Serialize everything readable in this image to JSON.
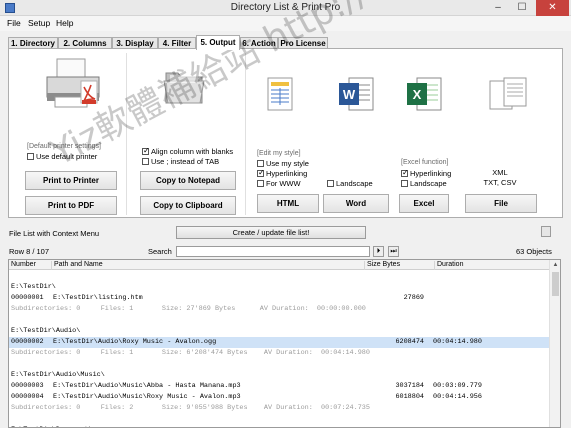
{
  "window": {
    "title": "Directory List & Print Pro",
    "minimize": "–",
    "maximize": "☐",
    "close": "✕"
  },
  "menu": [
    "File",
    "Setup",
    "Help"
  ],
  "tabs": [
    {
      "label": "1. Directory",
      "active": false
    },
    {
      "label": "2. Columns",
      "active": false
    },
    {
      "label": "3. Display",
      "active": false
    },
    {
      "label": "4. Filter",
      "active": false
    },
    {
      "label": "5. Output",
      "active": true
    },
    {
      "label": "6. Action",
      "active": false
    },
    {
      "label": "Pro License",
      "active": false
    }
  ],
  "printer": {
    "icon": "printer-pdf-icon",
    "group_label": "[Default printer settings]",
    "use_default": {
      "label": "Use default printer",
      "checked": false
    },
    "print_button": "Print to Printer",
    "pdf_button": "Print to PDF"
  },
  "clipboard": {
    "icon": "folder-icon",
    "align_columns": {
      "label": "Align column with blanks",
      "checked": true
    },
    "use_semicolon": {
      "label": "Use  ;  instead of TAB",
      "checked": false
    },
    "notepad_button": "Copy to Notepad",
    "clipboard_button": "Copy to Clipboard"
  },
  "style": {
    "icons": [
      "html-table-icon",
      "word-icon",
      "excel-icon",
      "xml-csv-icon"
    ],
    "edit_label": "[Edit my style]",
    "use_my_style": {
      "label": "Use my style",
      "checked": false
    },
    "hyperlinking": {
      "label": "Hyperlinking",
      "checked": true
    },
    "for_www": {
      "label": "For WWW",
      "checked": false
    },
    "landscape": {
      "label": "Landscape",
      "checked": false
    },
    "html_button": "HTML",
    "word_button": "Word",
    "excel_label": "[Excel function]",
    "excel_hyperlinking": {
      "label": "Hyperlinking",
      "checked": true
    },
    "excel_landscape": {
      "label": "Landscape",
      "checked": false
    },
    "excel_button": "Excel",
    "file_types": "XML\nTXT, CSV",
    "file_button": "File"
  },
  "status": {
    "context_menu": "File List with Context Menu",
    "create_button": "Create / update file list!",
    "row_counter": "Row 8 / 107",
    "search_label": "Search",
    "search_value": "",
    "next_button": "⏵",
    "last_button": "⏭",
    "objects": "63 Objects"
  },
  "list": {
    "columns": [
      "Number",
      "Path and Name",
      "Size Bytes",
      "Duration"
    ],
    "rows": [
      {
        "type": "blank",
        "text": ""
      },
      {
        "type": "dir",
        "text": "E:\\TestDir\\"
      },
      {
        "type": "file",
        "number": "00000001",
        "path": "E:\\TestDir\\listing.htm",
        "size": "27869",
        "duration": ""
      },
      {
        "type": "summary",
        "text": "Subdirectories: 0     Files: 1       Size: 27'869 Bytes      AV Duration:  00:00:00.000"
      },
      {
        "type": "blank",
        "text": ""
      },
      {
        "type": "dir",
        "text": "E:\\TestDir\\Audio\\"
      },
      {
        "type": "file",
        "number": "00000002",
        "path": "E:\\TestDir\\Audio\\Roxy Music - Avalon.ogg",
        "size": "6208474",
        "duration": "00:04:14.980",
        "selected": true
      },
      {
        "type": "summary",
        "text": "Subdirectories: 0     Files: 1       Size: 6'208'474 Bytes    AV Duration:  00:04:14.980"
      },
      {
        "type": "blank",
        "text": ""
      },
      {
        "type": "dir",
        "text": "E:\\TestDir\\Audio\\Music\\"
      },
      {
        "type": "file",
        "number": "00000003",
        "path": "E:\\TestDir\\Audio\\Music\\Abba - Hasta Manana.mp3",
        "size": "3037184",
        "duration": "00:03:09.779"
      },
      {
        "type": "file",
        "number": "00000004",
        "path": "E:\\TestDir\\Audio\\Music\\Roxy Music - Avalon.mp3",
        "size": "6018804",
        "duration": "00:04:14.956"
      },
      {
        "type": "summary",
        "text": "Subdirectories: 0     Files: 2       Size: 9'055'988 Bytes    AV Duration:  00:07:24.735"
      },
      {
        "type": "blank",
        "text": ""
      },
      {
        "type": "dir",
        "text": "E:\\TestDir\\Document\\"
      }
    ]
  },
  "watermark": "Yiz軟體補給站 http://31.to"
}
